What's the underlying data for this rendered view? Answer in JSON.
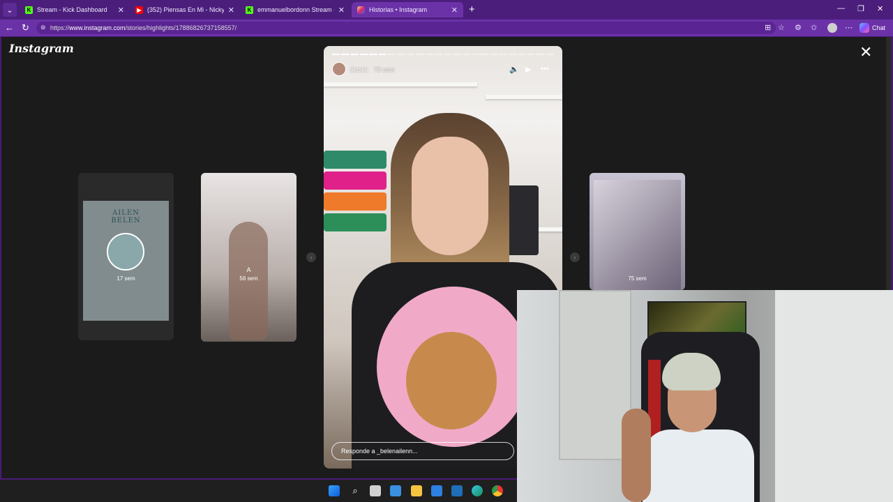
{
  "browser": {
    "tabs": [
      {
        "title": "Stream - Kick Dashboard",
        "favicon": "kick-icon",
        "active": false
      },
      {
        "title": "(352) Piensas En Mi - Nicky Jam | Y",
        "favicon": "youtube-icon",
        "active": false
      },
      {
        "title": "emmanuelbordonn Stream - Watc",
        "favicon": "kick-icon",
        "active": false
      },
      {
        "title": "Historias • Instagram",
        "favicon": "instagram-icon",
        "active": true
      }
    ],
    "url_prefix": "https://",
    "url_host": "www.instagram.com",
    "url_path": "/stories/highlights/17886826737158557/",
    "chat_label": "Chat"
  },
  "instagram": {
    "logo": "Instagram",
    "cards": [
      {
        "time": "17 sem",
        "flyer_title": "AILEN\nBELEN"
      },
      {
        "avatar_letter": "A",
        "time": "56 sem"
      },
      {
        "time": "75 sem"
      }
    ],
    "story": {
      "username": "tiktokk",
      "time": "73 sem",
      "reply_placeholder": "Responde a _belenailenn...",
      "segments_total": 24,
      "segments_done": 6
    }
  },
  "colors": {
    "browser_frame": "#4b1e7c",
    "address_bar": "#6b32a8",
    "page_bg": "#1b1b1b"
  }
}
